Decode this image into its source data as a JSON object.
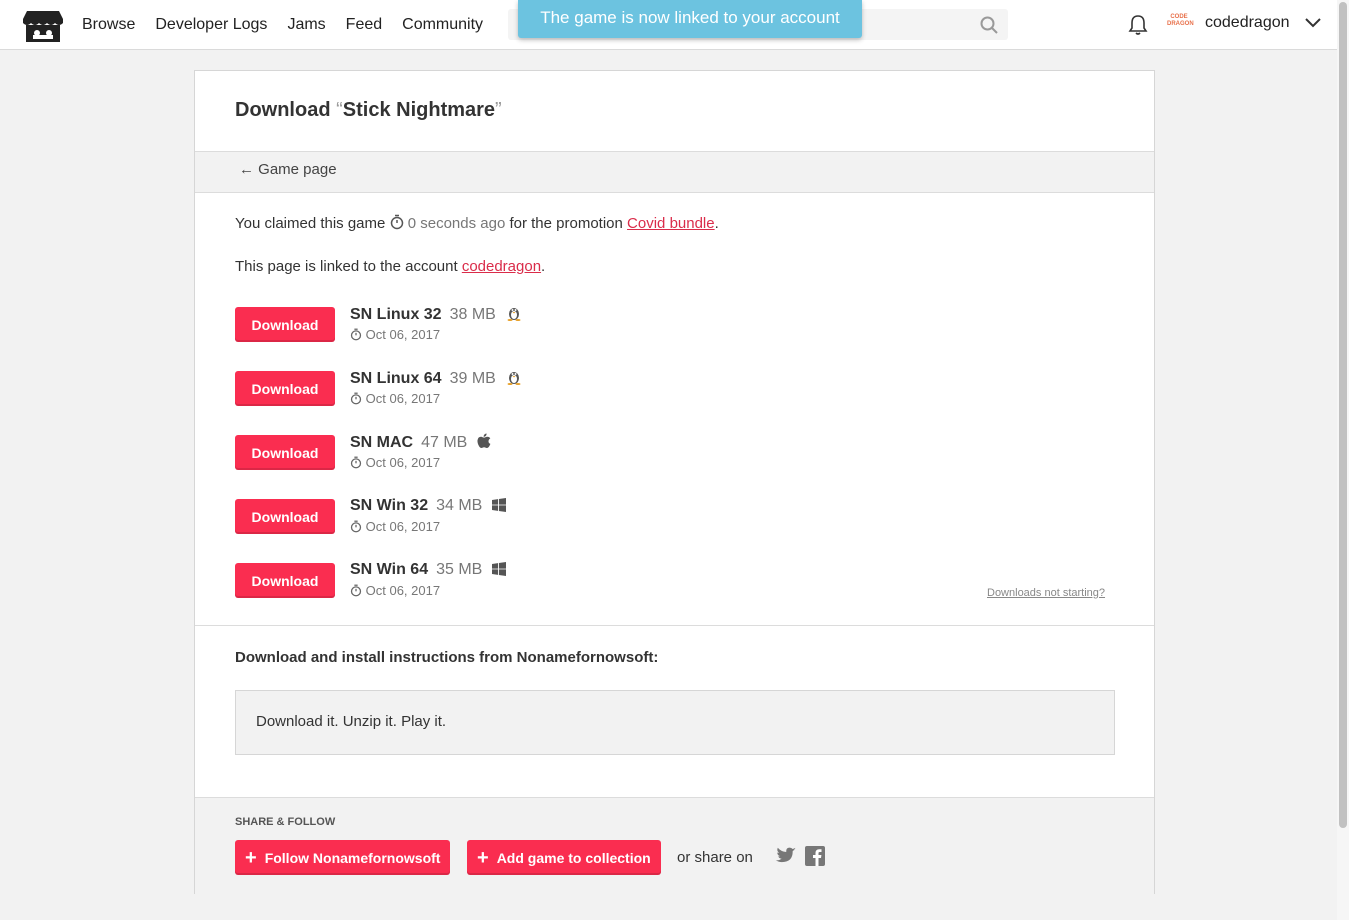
{
  "nav": {
    "items": [
      "Browse",
      "Developer Logs",
      "Jams",
      "Feed",
      "Community"
    ],
    "username": "codedragon",
    "avatar_text": [
      "CODE",
      "DRAGON"
    ]
  },
  "toast": "The game is now linked to your account",
  "page": {
    "title_prefix": "Download",
    "game_title": "Stick Nightmare",
    "back_link": "Game page",
    "claimed_text": "You claimed this game",
    "claimed_time": "0 seconds ago",
    "claimed_mid": "for the promotion",
    "promotion": "Covid bundle",
    "linked_text": "This page is linked to the account",
    "linked_account": "codedragon",
    "not_starting": "Downloads not starting?"
  },
  "uploads": [
    {
      "button": "Download",
      "name": "SN Linux 32",
      "size": "38 MB",
      "os": "linux-icon",
      "date": "Oct 06, 2017"
    },
    {
      "button": "Download",
      "name": "SN Linux 64",
      "size": "39 MB",
      "os": "linux-icon",
      "date": "Oct 06, 2017"
    },
    {
      "button": "Download",
      "name": "SN MAC",
      "size": "47 MB",
      "os": "apple-icon",
      "date": "Oct 06, 2017"
    },
    {
      "button": "Download",
      "name": "SN Win 32",
      "size": "34 MB",
      "os": "windows-icon",
      "date": "Oct 06, 2017"
    },
    {
      "button": "Download",
      "name": "SN Win 64",
      "size": "35 MB",
      "os": "windows-icon",
      "date": "Oct 06, 2017"
    }
  ],
  "instructions": {
    "title": "Download and install instructions from Nonamefornowsoft:",
    "body": "Download it. Unzip it. Play it."
  },
  "share": {
    "label": "SHARE & FOLLOW",
    "follow_button": "Follow Nonamefornowsoft",
    "collection_button": "Add game to collection",
    "or_share": "or share on"
  },
  "colors": {
    "accent": "#fa2d50",
    "toast": "#6cc3e0",
    "link": "#da2c4a"
  }
}
